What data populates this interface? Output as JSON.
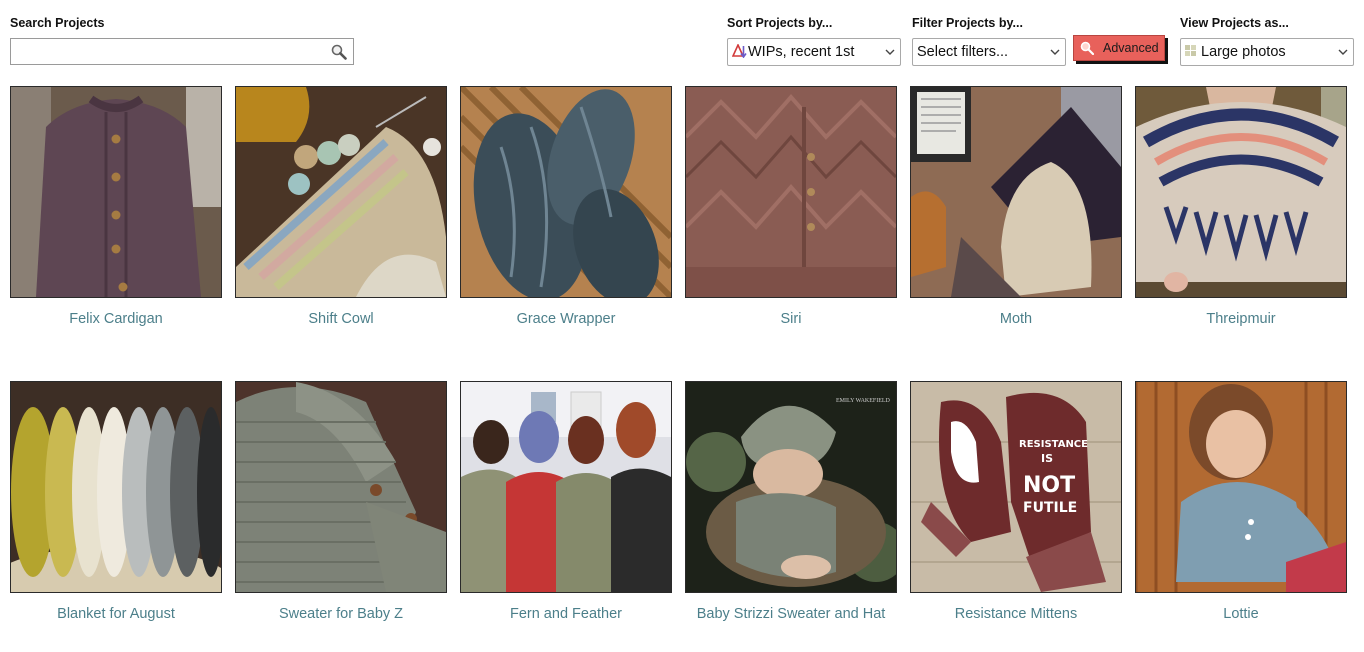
{
  "search": {
    "label": "Search Projects",
    "value": "",
    "placeholder": ""
  },
  "sort": {
    "label": "Sort Projects by...",
    "selected": "WIPs, recent 1st"
  },
  "filter": {
    "label": "Filter Projects by...",
    "selected": "Select filters...",
    "advanced_label": "Advanced"
  },
  "view": {
    "label": "View Projects as...",
    "selected": "Large photos"
  },
  "projects": [
    {
      "title": "Felix Cardigan"
    },
    {
      "title": "Shift Cowl"
    },
    {
      "title": "Grace Wrapper"
    },
    {
      "title": "Siri"
    },
    {
      "title": "Moth"
    },
    {
      "title": "Threipmuir"
    },
    {
      "title": "Blanket for August"
    },
    {
      "title": "Sweater for Baby Z"
    },
    {
      "title": "Fern and Feather"
    },
    {
      "title": "Baby Strizzi Sweater and Hat"
    },
    {
      "title": "Resistance Mittens"
    },
    {
      "title": "Lottie"
    }
  ],
  "photo_watermarks": {
    "baby_photo": "EMILY WAKEFIELD"
  },
  "mitten_text": [
    "RESISTANCE",
    "IS",
    "NOT",
    "FUTILE"
  ],
  "colors": {
    "link": "#4c7f8a",
    "advanced_button": "#e8615b"
  }
}
